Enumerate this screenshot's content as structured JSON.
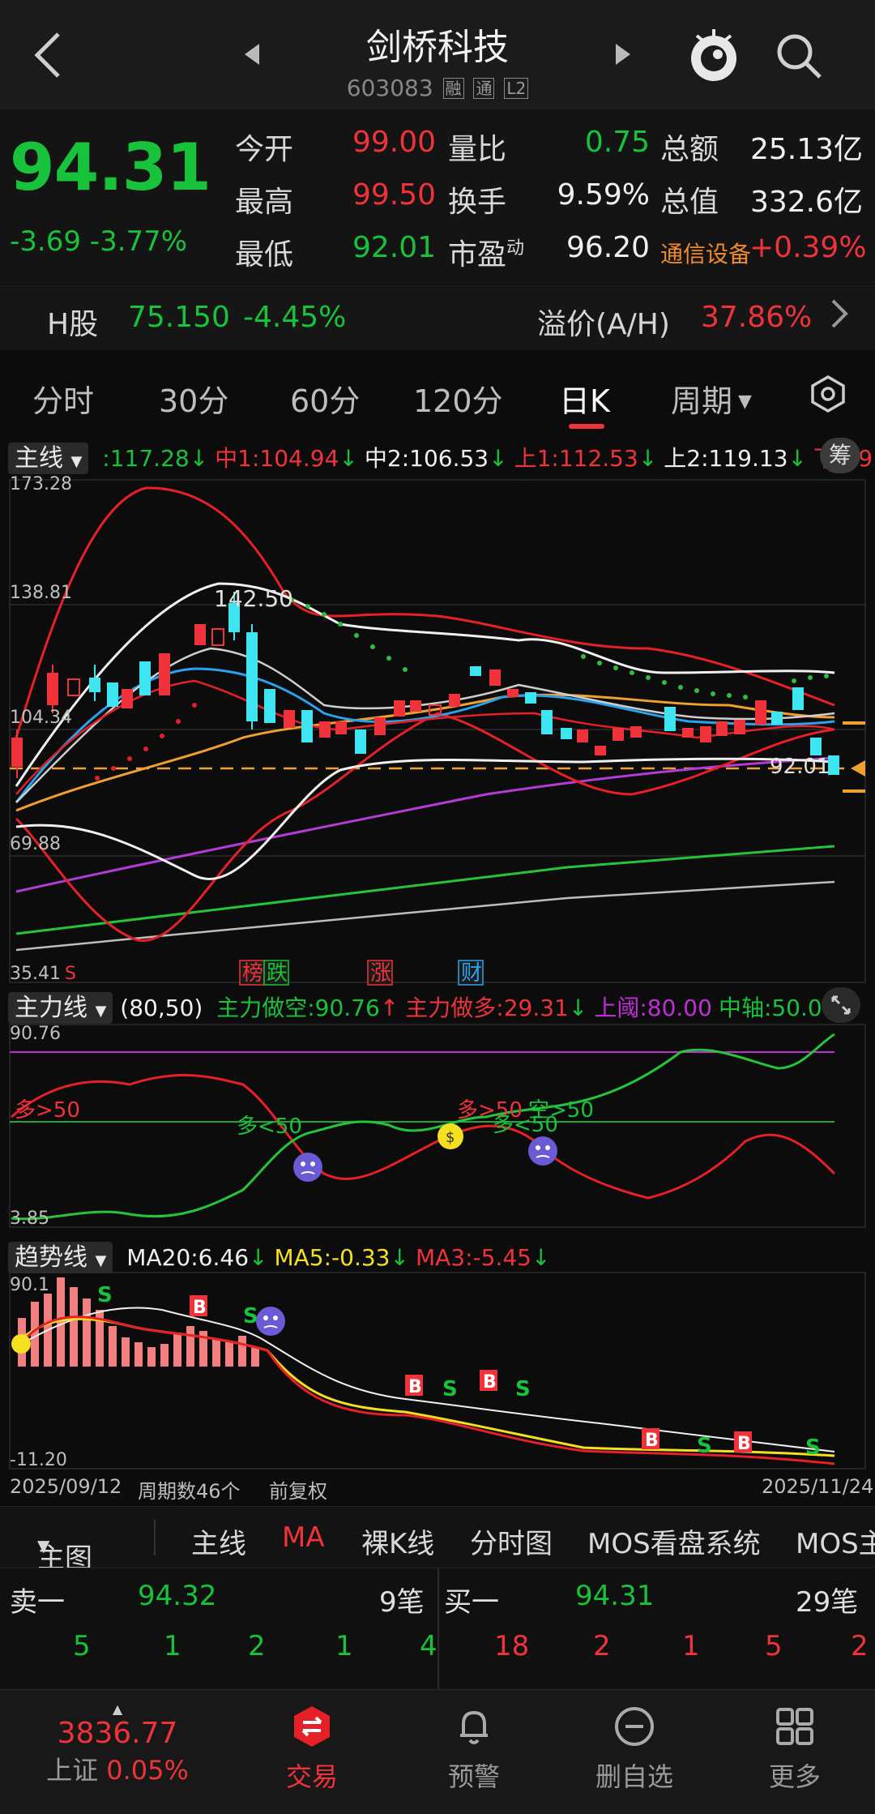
{
  "header": {
    "stock_name": "剑桥科技",
    "stock_code": "603083",
    "tags": [
      "融",
      "通",
      "L2"
    ]
  },
  "quote": {
    "price": "94.31",
    "change": "-3.69",
    "change_pct": "-3.77%",
    "rows": [
      {
        "l1": "今开",
        "v1": "99.00",
        "v1c": "red",
        "l2": "量比",
        "v2": "0.75",
        "v2c": "green",
        "l3": "总额",
        "v3": "25.13亿",
        "v3c": "white"
      },
      {
        "l1": "最高",
        "v1": "99.50",
        "v1c": "red",
        "l2": "换手",
        "v2": "9.59%",
        "v2c": "white",
        "l3": "总值",
        "v3": "332.6亿",
        "v3c": "white"
      },
      {
        "l1": "最低",
        "v1": "92.01",
        "v1c": "green",
        "l2": "市盈",
        "v2": "96.20",
        "v2c": "white",
        "l3": "通信设备",
        "v3": "+0.39%",
        "v3c": "red"
      }
    ],
    "pe_superscript": "动"
  },
  "hshare": {
    "label": "H股",
    "price": "75.150",
    "pct": "-4.45%",
    "premium_label": "溢价(A/H)",
    "premium": "37.86%"
  },
  "tabs": [
    "分时",
    "30分",
    "60分",
    "120分",
    "日K",
    "周期"
  ],
  "active_tab": "日K",
  "main_legend": {
    "name": "主线",
    "items": [
      {
        "text": ":117.28",
        "color": "#18c23a",
        "arrow": "↓",
        "arrow_color": "#18c23a"
      },
      {
        "text": "中1:104.94",
        "color": "#f0333b",
        "arrow": "↓",
        "arrow_color": "#18c23a"
      },
      {
        "text": "中2:106.53",
        "color": "#f0f0f0",
        "arrow": "↓",
        "arrow_color": "#18c23a"
      },
      {
        "text": "上1:112.53",
        "color": "#f0333b",
        "arrow": "↓",
        "arrow_color": "#18c23a"
      },
      {
        "text": "上2:119.13",
        "color": "#f0f0f0",
        "arrow": "↓",
        "arrow_color": "#18c23a"
      },
      {
        "text": "下1:9",
        "color": "#f0333b",
        "arrow": "",
        "arrow_color": "#18c23a"
      }
    ],
    "badge": "筹"
  },
  "main_axis": [
    "173.28",
    "138.81",
    "104.34",
    "69.88",
    "35.41"
  ],
  "main_annotations": {
    "high": "142.50",
    "last": "92.01",
    "s_mark": "S"
  },
  "main_events": [
    "榜",
    "跌",
    "涨",
    "财"
  ],
  "flow_legend": {
    "name": "主力线",
    "params": "(80,50)",
    "items": [
      {
        "text": "主力做空:90.76",
        "color": "#18c23a",
        "arrow": "↑",
        "arrow_color": "#f0333b"
      },
      {
        "text": "主力做多:29.31",
        "color": "#f0333b",
        "arrow": "↓",
        "arrow_color": "#18c23a"
      },
      {
        "text": "上阈:80.00",
        "color": "#c02ed6",
        "arrow": "",
        "arrow_color": ""
      },
      {
        "text": "中轴:50.00",
        "color": "#18c23a",
        "arrow": "",
        "arrow_color": ""
      }
    ]
  },
  "flow_axis": [
    "90.76",
    "3.85"
  ],
  "flow_labels": [
    "多>50",
    "多<50",
    "多>50",
    "空>50",
    "多<50"
  ],
  "trend_legend": {
    "name": "趋势线",
    "items": [
      {
        "text": "MA20:6.46",
        "color": "#f0f0f0",
        "arrow": "↓",
        "arrow_color": "#18c23a"
      },
      {
        "text": "MA5:-0.33",
        "color": "#f5e020",
        "arrow": "↓",
        "arrow_color": "#18c23a"
      },
      {
        "text": "MA3:-5.45",
        "color": "#f0333b",
        "arrow": "↓",
        "arrow_color": "#18c23a"
      }
    ]
  },
  "trend_axis": [
    "90.1",
    "-11.20"
  ],
  "date_row": {
    "start": "2025/09/12",
    "period_count": "周期数46个",
    "adjust": "前复权",
    "end": "2025/11/24"
  },
  "indicator_tabs": [
    "主图",
    "主线",
    "MA",
    "裸K线",
    "分时图",
    "MOS看盘系统",
    "MOS主"
  ],
  "orderbook": {
    "sell_label": "卖一",
    "sell_price": "94.32",
    "sell_count": "9笔",
    "buy_label": "买一",
    "buy_price": "94.31",
    "buy_count": "29笔",
    "sell_sizes": [
      "5",
      "1",
      "2",
      "1",
      "4"
    ],
    "buy_sizes": [
      "18",
      "2",
      "1",
      "5",
      "2"
    ]
  },
  "bottom_nav": {
    "index_value": "3836.77",
    "index_name": "上证",
    "index_pct": "0.05%",
    "items": [
      "交易",
      "预警",
      "删自选",
      "更多"
    ]
  },
  "colors": {
    "up": "#f0333b",
    "down": "#18c23a",
    "bg": "#0c0c0c"
  }
}
